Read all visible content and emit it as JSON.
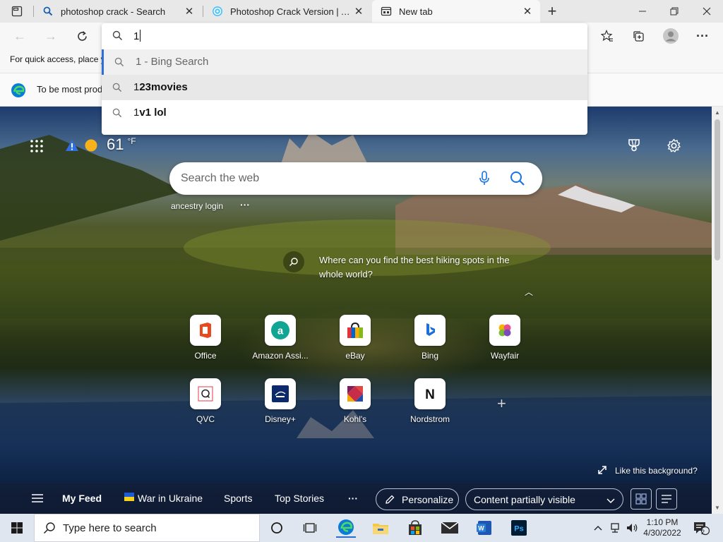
{
  "tabs": [
    {
      "title": "photoshop crack - Search",
      "favicon": "search-icon",
      "active": false
    },
    {
      "title": "Photoshop Crack Version | Adob",
      "favicon": "site-icon",
      "active": false
    },
    {
      "title": "New tab",
      "favicon": "newtab-page-icon",
      "active": true
    }
  ],
  "favorites_bar": {
    "text": "For quick access, place y"
  },
  "info_bar": {
    "text": "To be most prod"
  },
  "omnibox": {
    "value": "1",
    "suggestions": [
      {
        "prefix": "1",
        "rest": " - Bing Search"
      },
      {
        "prefix": "1",
        "rest": "23movies"
      },
      {
        "prefix": "1",
        "rest": "v1 lol"
      }
    ]
  },
  "weather": {
    "temp": "61",
    "unit": "°F"
  },
  "search": {
    "placeholder": "Search the web"
  },
  "trending": {
    "link": "ancestry login",
    "more": "···"
  },
  "hint": {
    "text": "Where can you find the best hiking spots in the whole world?"
  },
  "tiles": [
    {
      "label": "Office",
      "icon": "office-icon"
    },
    {
      "label": "Amazon Assi...",
      "icon": "amazon-icon"
    },
    {
      "label": "eBay",
      "icon": "ebay-icon"
    },
    {
      "label": "Bing",
      "icon": "bing-icon"
    },
    {
      "label": "Wayfair",
      "icon": "wayfair-icon"
    },
    {
      "label": "QVC",
      "icon": "qvc-icon"
    },
    {
      "label": "Disney+",
      "icon": "disney-icon"
    },
    {
      "label": "Kohl's",
      "icon": "kohls-icon"
    },
    {
      "label": "Nordstrom",
      "icon": "nordstrom-icon"
    }
  ],
  "like_background": "Like this background?",
  "feed": {
    "my_feed": "My Feed",
    "war": "War in Ukraine",
    "sports": "Sports",
    "top_stories": "Top Stories",
    "more": "···",
    "personalize": "Personalize",
    "content_visible": "Content partially visible"
  },
  "taskbar": {
    "search_placeholder": "Type here to search",
    "time": "1:10 PM",
    "date": "4/30/2022",
    "notifications": "2"
  },
  "colors": {
    "accent": "#2d6fd6",
    "edge_blue": "#0a7cd6"
  }
}
